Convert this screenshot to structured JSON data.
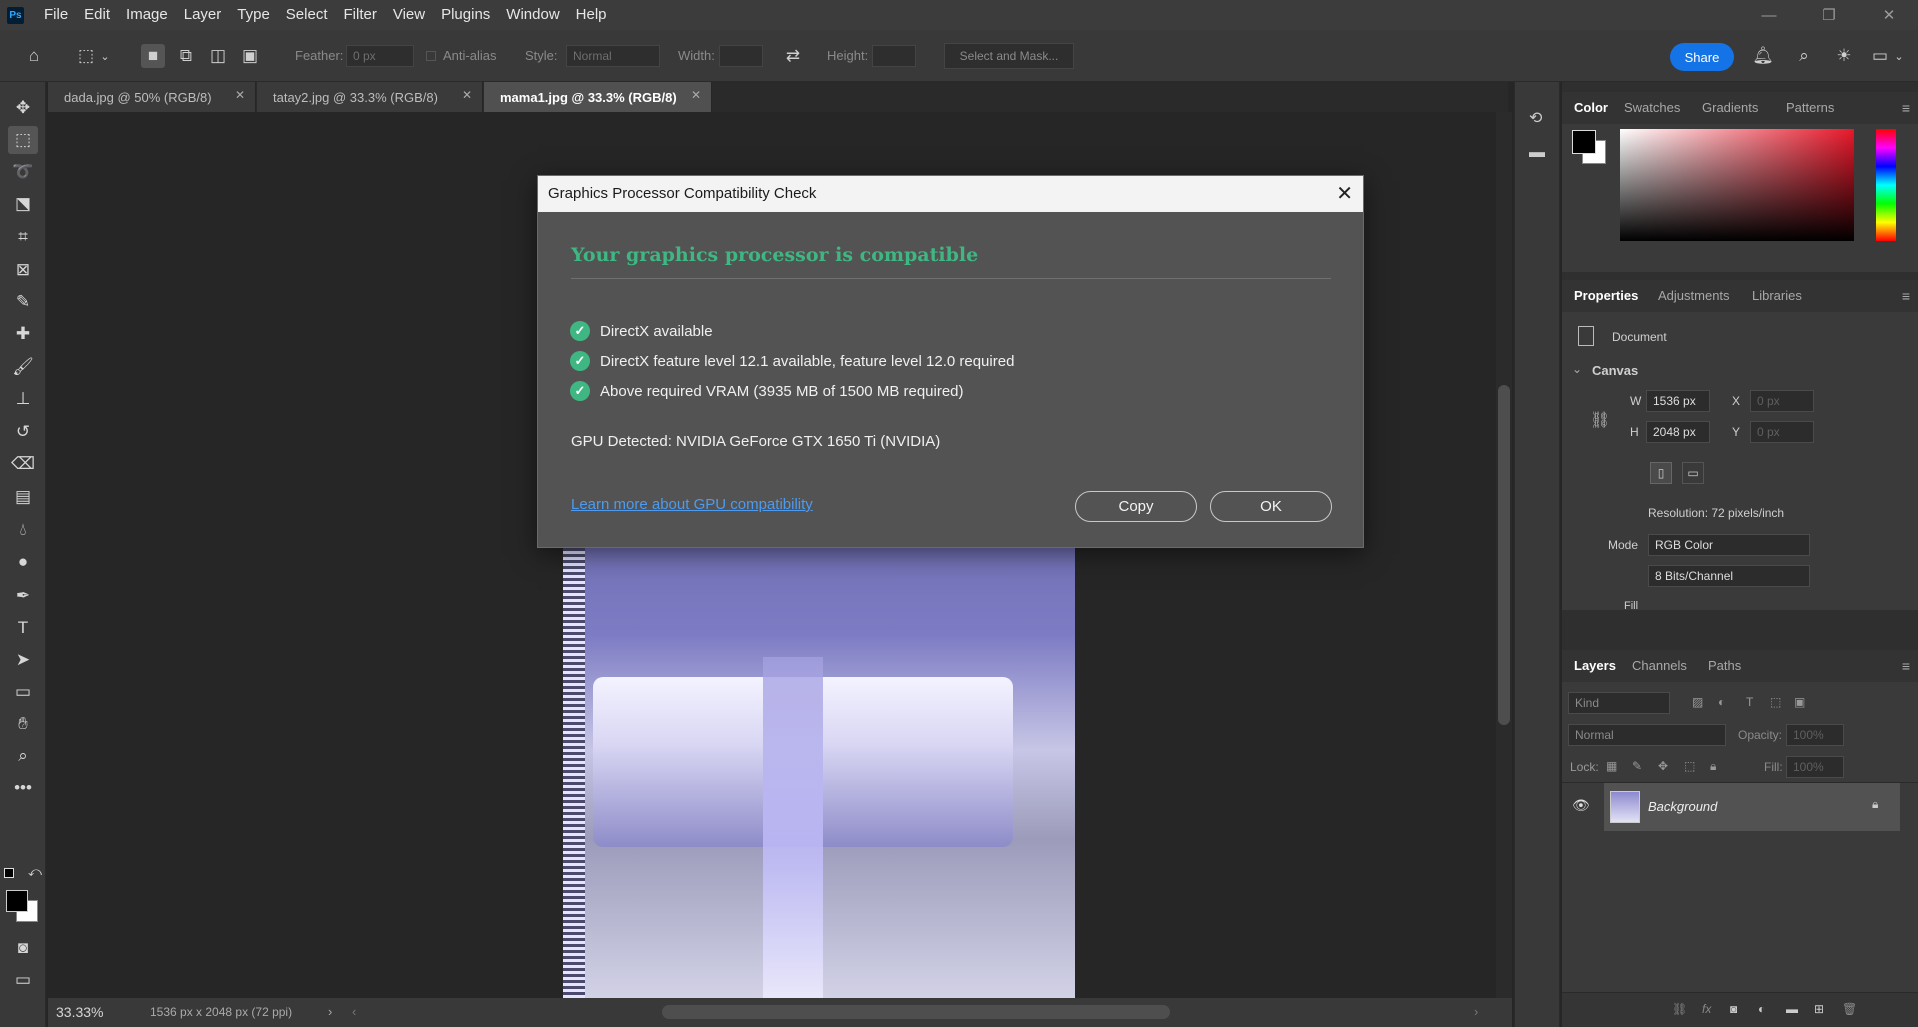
{
  "app": {
    "logo": "Ps",
    "menu": [
      "File",
      "Edit",
      "Image",
      "Layer",
      "Type",
      "Select",
      "Filter",
      "View",
      "Plugins",
      "Window",
      "Help"
    ],
    "window_controls": {
      "minimize": "—",
      "restore": "❐",
      "close": "✕"
    }
  },
  "options_bar": {
    "feather_label": "Feather:",
    "feather_value": "0 px",
    "antialias_label": "Anti-alias",
    "style_label": "Style:",
    "style_value": "Normal",
    "width_label": "Width:",
    "height_label": "Height:",
    "select_mask": "Select and Mask...",
    "share": "Share"
  },
  "tabs": [
    {
      "label": "dada.jpg @ 50% (RGB/8)",
      "active": false
    },
    {
      "label": "tatay2.jpg @ 33.3% (RGB/8)",
      "active": false
    },
    {
      "label": "mama1.jpg @ 33.3% (RGB/8)",
      "active": true
    }
  ],
  "status_bar": {
    "zoom": "33.33%",
    "doc_info": "1536 px x 2048 px (72 ppi)"
  },
  "color_panel": {
    "tabs": [
      "Color",
      "Swatches",
      "Gradients",
      "Patterns"
    ],
    "active_tab": "Color",
    "foreground": "#000000",
    "background": "#ffffff",
    "hue_color": "#e8182a"
  },
  "properties_panel": {
    "tabs": [
      "Properties",
      "Adjustments",
      "Libraries"
    ],
    "document_label": "Document",
    "section": "Canvas",
    "w_label": "W",
    "w_value": "1536 px",
    "h_label": "H",
    "h_value": "2048 px",
    "x_label": "X",
    "x_value": "0 px",
    "y_label": "Y",
    "y_value": "0 px",
    "resolution": "Resolution: 72 pixels/inch",
    "mode_label": "Mode",
    "mode_value": "RGB Color",
    "bits_value": "8 Bits/Channel",
    "fill_label": "Fill"
  },
  "layers_panel": {
    "tabs": [
      "Layers",
      "Channels",
      "Paths"
    ],
    "kind_placeholder": "Kind",
    "blend_mode": "Normal",
    "opacity_label": "Opacity:",
    "opacity_value": "100%",
    "lock_label": "Lock:",
    "fill_label": "Fill:",
    "fill_value": "100%",
    "layers": [
      {
        "name": "Background",
        "locked": true,
        "visible": true
      }
    ]
  },
  "dialog": {
    "title": "Graphics Processor Compatibility Check",
    "heading": "Your graphics processor is compatible",
    "checks": [
      "DirectX available",
      "DirectX feature level 12.1 available, feature level 12.0 required",
      "Above required VRAM (3935 MB of 1500 MB required)"
    ],
    "gpu_detected": "GPU Detected: NVIDIA GeForce GTX 1650 Ti (NVIDIA)",
    "learn_more": "Learn more about GPU compatibility",
    "copy_button": "Copy",
    "ok_button": "OK",
    "accent": "#3fb783"
  }
}
